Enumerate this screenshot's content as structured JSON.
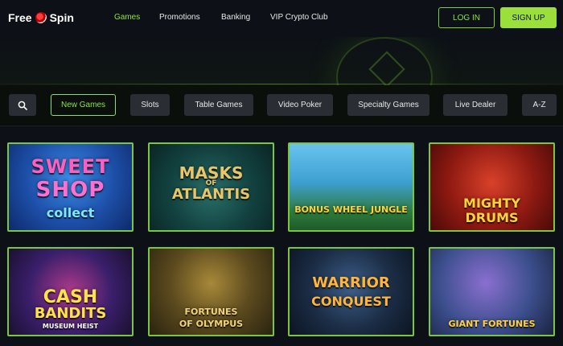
{
  "brand": {
    "part1": "Free",
    "part2": "Spin"
  },
  "nav": {
    "items": [
      "Games",
      "Promotions",
      "Banking",
      "VIP Crypto Club"
    ]
  },
  "auth": {
    "login": "LOG IN",
    "signup": "SIGN UP"
  },
  "filters": [
    "New Games",
    "Slots",
    "Table Games",
    "Video Poker",
    "Specialty Games",
    "Live Dealer",
    "A-Z"
  ],
  "games": [
    {
      "line1": "SWEET",
      "line2": "SHOP",
      "line3": "collect"
    },
    {
      "line1": "MASKS",
      "line2": "ATLANTIS",
      "small": "OF"
    },
    {
      "line1": "BONUS WHEEL JUNGLE"
    },
    {
      "line1": "MIGHTY",
      "line2": "DRUMS"
    },
    {
      "line1": "CASH",
      "line2": "BANDITS",
      "line3": "MUSEUM HEIST"
    },
    {
      "line1": "FORTUNES",
      "line2": "OF OLYMPUS"
    },
    {
      "line1": "WARRIOR",
      "line2": "CONQUEST"
    },
    {
      "line1": "GIANT FORTUNES"
    }
  ],
  "colors": {
    "accent": "#8fe33a",
    "background": "#0d1117",
    "chip": "#2a2e34"
  }
}
